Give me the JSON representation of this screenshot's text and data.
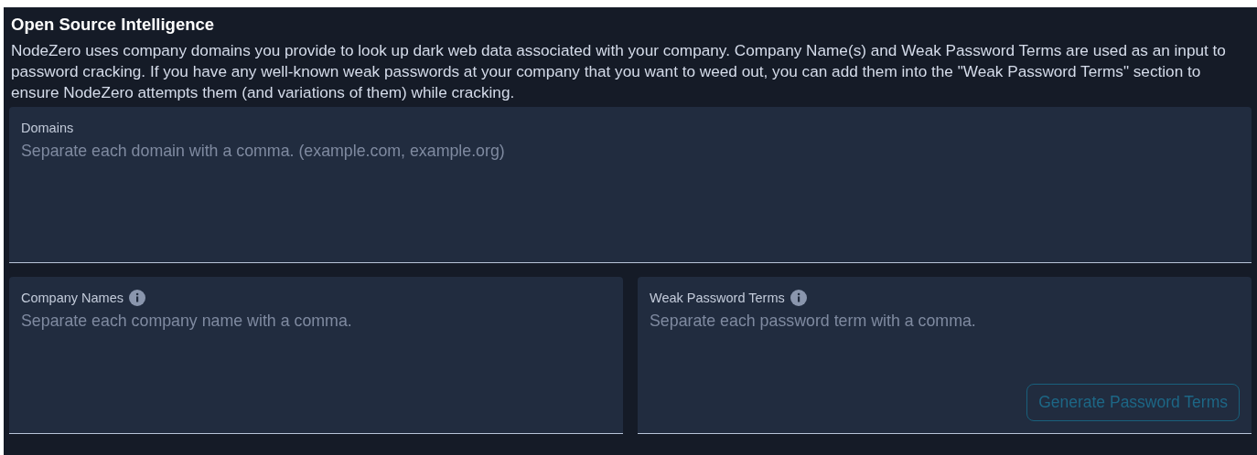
{
  "section": {
    "title": "Open Source Intelligence",
    "description": "NodeZero uses company domains you provide to look up dark web data associated with your company. Company Name(s) and Weak Password Terms are used as an input to password cracking. If you have any well-known weak passwords at your company that you want to weed out, you can add them into the \"Weak Password Terms\" section to ensure NodeZero attempts them (and variations of them) while cracking."
  },
  "fields": [
    {
      "label": "Domains",
      "placeholder": "Separate each domain with a comma. (example.com, example.org)",
      "info": false
    },
    {
      "label": "Company Names",
      "placeholder": "Separate each company name with a comma.",
      "info": true
    },
    {
      "label": "Weak Password Terms",
      "placeholder": "Separate each password term with a comma.",
      "info": true
    }
  ],
  "generate_button": {
    "label": "Generate Password Terms",
    "disabled": true
  }
}
